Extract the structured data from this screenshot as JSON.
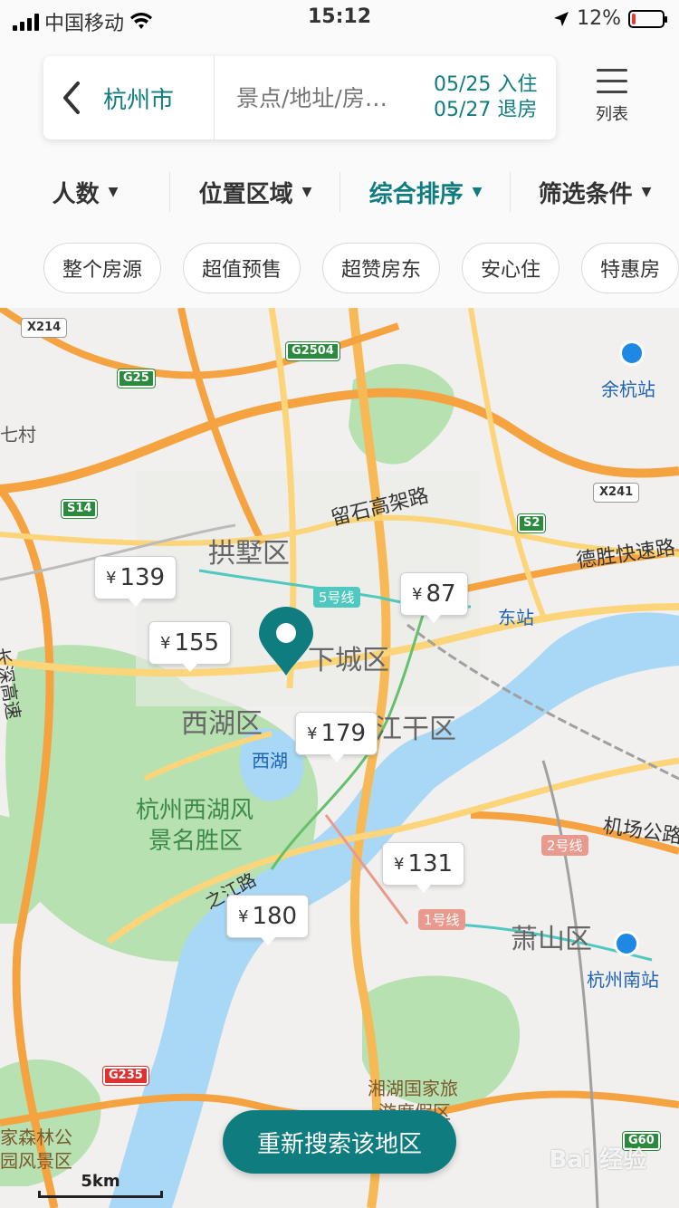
{
  "status_bar": {
    "carrier": "中国移动",
    "time": "15:12",
    "battery": "12%",
    "battery_level": 0.12
  },
  "search": {
    "city": "杭州市",
    "placeholder": "景点/地址/房…",
    "checkin": "05/25 入住",
    "checkout": "05/27 退房"
  },
  "list_button": {
    "label": "列表",
    "icon": "list-icon"
  },
  "filters": [
    {
      "label": "人数",
      "active": false
    },
    {
      "label": "位置区域",
      "active": false
    },
    {
      "label": "综合排序",
      "active": true
    },
    {
      "label": "筛选条件",
      "active": false
    }
  ],
  "tags": [
    "整个房源",
    "超值预售",
    "超赞房东",
    "安心住",
    "特惠房"
  ],
  "map": {
    "labels": {
      "gongshu": "拱墅区",
      "xiacheng": "下城区",
      "xihu_district": "西湖区",
      "jianggan": "江干区",
      "xihu_lake": "西湖",
      "scenic_1": "杭州西湖风",
      "scenic_2": "景名胜区",
      "xiaoshan": "萧山区",
      "liushi": "留石高架路",
      "desheng": "德胜快速路",
      "airport": "机场公路",
      "changshen": "长深高速",
      "zhijiang": "之江路",
      "yuhang_station": "余杭站",
      "south_station": "杭州南站",
      "xianghu_1": "湘湖国家旅",
      "xianghu_2": "游度假区",
      "forest_1": "家森林公",
      "forest_2": "园风景区",
      "village": "七村",
      "east_station": "东站"
    },
    "road_shields": [
      "G2504",
      "G25",
      "S14",
      "S2",
      "G235",
      "G60",
      "X214",
      "X241"
    ],
    "metro_lines": [
      "5号线",
      "2号线",
      "1号线"
    ],
    "prices": [
      {
        "label": "139"
      },
      {
        "label": "155"
      },
      {
        "label": "87"
      },
      {
        "label": "179"
      },
      {
        "label": "131"
      },
      {
        "label": "180"
      }
    ],
    "research_button": "重新搜索该地区",
    "scale": "5km",
    "watermark": "Bai 经验"
  },
  "colors": {
    "accent": "#0f7c7f",
    "water": "#a8d8f5",
    "park": "#b7e1b1",
    "highway": "#f5a340",
    "road": "#fcd57a"
  }
}
